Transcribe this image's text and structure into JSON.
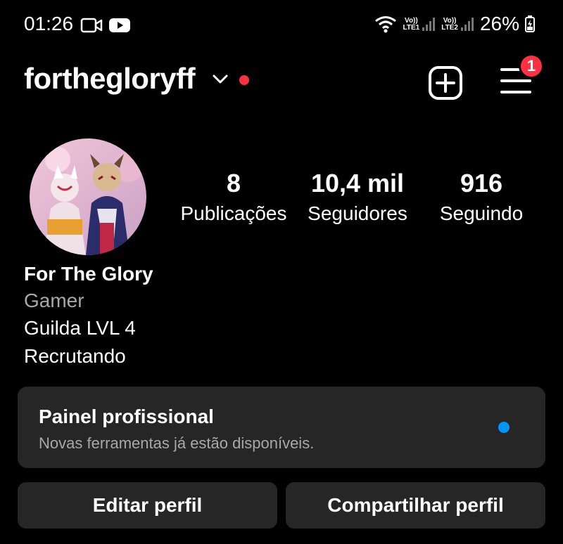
{
  "status_bar": {
    "time": "01:26",
    "sim1": {
      "top": "Vo))",
      "bottom": "LTE1"
    },
    "sim2": {
      "top": "Vo))",
      "bottom": "LTE2"
    },
    "battery": "26%"
  },
  "header": {
    "username": "forthegloryff",
    "notification_count": "1"
  },
  "profile": {
    "stats": [
      {
        "value": "8",
        "label": "Publicações"
      },
      {
        "value": "10,4 mil",
        "label": "Seguidores"
      },
      {
        "value": "916",
        "label": "Seguindo"
      }
    ],
    "name": "For The Glory",
    "category": "Gamer",
    "bio_lines": [
      "Guilda LVL 4",
      "Recrutando"
    ]
  },
  "dashboard": {
    "title": "Painel profissional",
    "subtitle": "Novas ferramentas já estão disponíveis."
  },
  "buttons": {
    "edit": "Editar perfil",
    "share": "Compartilhar perfil"
  },
  "colors": {
    "background": "#000000",
    "card": "#262626",
    "notification_red": "#ff3040",
    "accent_blue": "#0095f6",
    "secondary_text": "#a8a8a8"
  },
  "icons": [
    "video-call-icon",
    "youtube-icon",
    "wifi-icon",
    "signal-icon",
    "battery-charging-icon",
    "chevron-down-icon",
    "new-post-icon",
    "menu-icon"
  ]
}
